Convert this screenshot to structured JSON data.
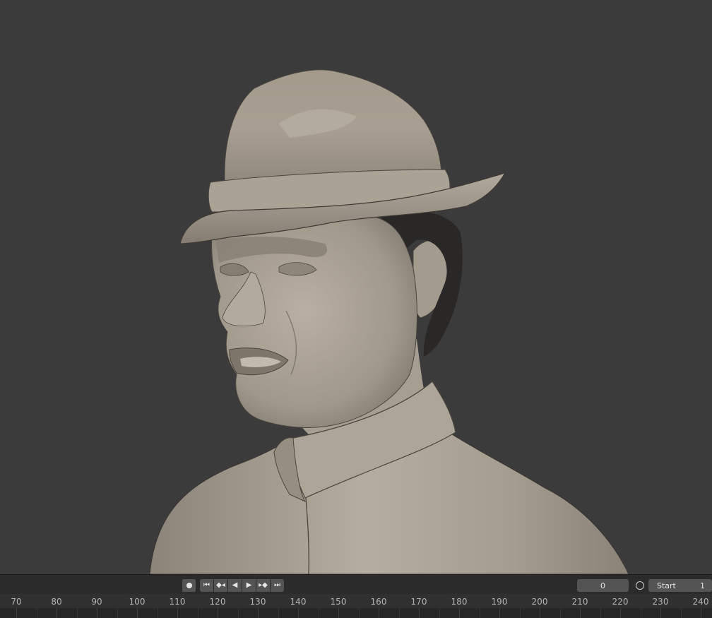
{
  "viewport": {
    "subject": "sculpted-bust",
    "background_color": "#3b3b3b",
    "clay_color": "#b0a89c",
    "hair_color": "#2a2826"
  },
  "playback": {
    "record_icon": "record-icon",
    "jump_start_icon": "jump-to-start-icon",
    "prev_keyframe_icon": "previous-keyframe-icon",
    "play_reverse_icon": "play-reverse-icon",
    "play_icon": "play-icon",
    "next_keyframe_icon": "next-keyframe-icon",
    "jump_end_icon": "jump-to-end-icon",
    "current_frame": "0",
    "stopwatch_icon": "stopwatch-icon",
    "start_label": "Start",
    "start_value": "1"
  },
  "timeline": {
    "ticks": [
      "70",
      "80",
      "90",
      "100",
      "110",
      "120",
      "130",
      "140",
      "150",
      "160",
      "170",
      "180",
      "190",
      "200",
      "210",
      "220",
      "230",
      "240"
    ]
  }
}
